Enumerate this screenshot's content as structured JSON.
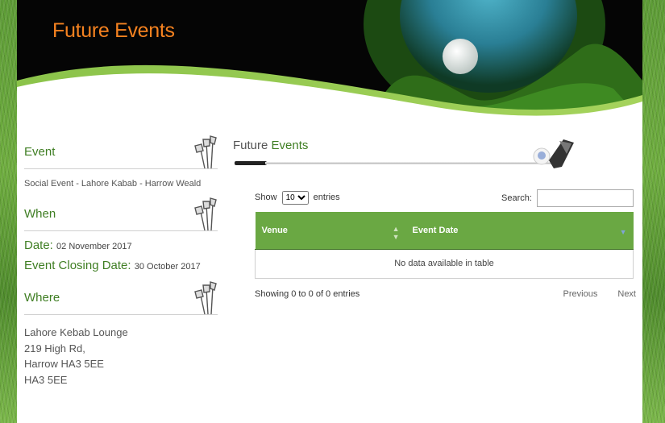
{
  "header": {
    "title": "Future Events"
  },
  "sidebar": {
    "event": {
      "heading": "Event",
      "text": "Social Event - Lahore Kabab - Harrow Weald"
    },
    "when": {
      "heading": "When",
      "date_label": "Date:",
      "date_value": "02 November 2017",
      "closing_label": "Event Closing Date:",
      "closing_value": "30 October 2017"
    },
    "where": {
      "heading": "Where",
      "address": [
        "Lahore Kebab Lounge",
        "219 High Rd,",
        "Harrow HA3 5EE",
        "HA3 5EE"
      ]
    }
  },
  "main": {
    "title_part1": "Future",
    "title_part2": "Events",
    "table": {
      "show_label": "Show",
      "entries_label": "entries",
      "length_value": "10",
      "search_label": "Search:",
      "columns": [
        "Venue",
        "Event Date"
      ],
      "empty_message": "No data available in table",
      "info": "Showing 0 to 0 of 0 entries",
      "previous": "Previous",
      "next": "Next"
    }
  },
  "colors": {
    "accent_orange": "#f58220",
    "brand_green": "#3f7e23",
    "header_green": "#6aa843"
  }
}
